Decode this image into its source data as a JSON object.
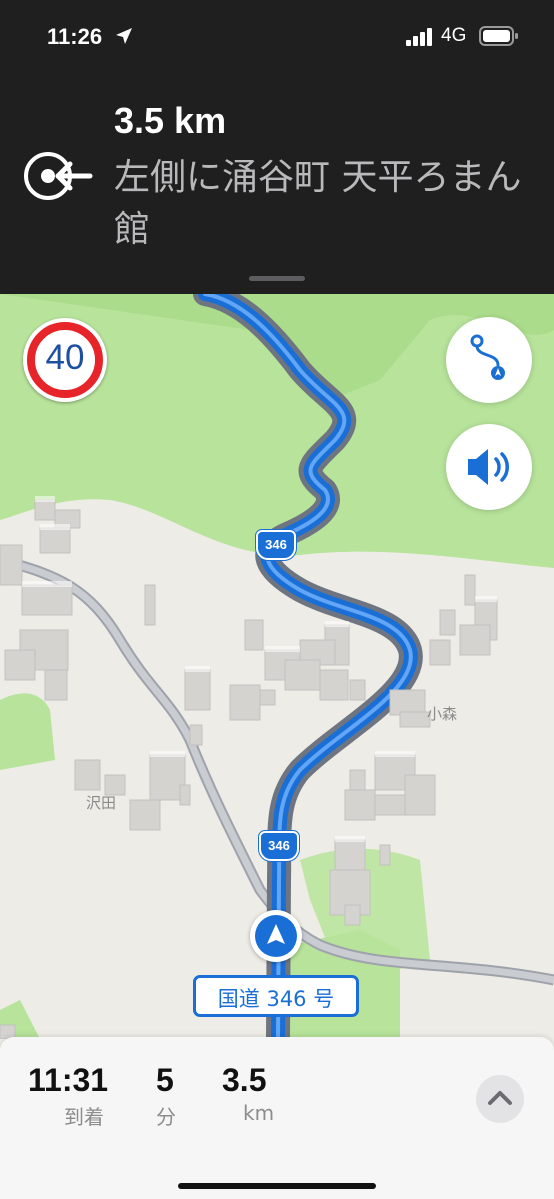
{
  "status_bar": {
    "time": "11:26",
    "network": "4G",
    "location_icon": "location-arrow-icon",
    "signal_icon": "cellular-signal-icon",
    "battery_icon": "battery-icon"
  },
  "guidance": {
    "distance": "3.5 km",
    "instruction": "左側に涌谷町 天平ろまん館",
    "maneuver_icon": "arrive-on-left-icon"
  },
  "map": {
    "speed_limit": "40",
    "route_shields": [
      "346",
      "346"
    ],
    "place_labels": [
      "小森",
      "沢田"
    ],
    "current_road": "国道 346 号",
    "buttons": {
      "route_overview_icon": "route-overview-icon",
      "audio_icon": "speaker-icon"
    },
    "colors": {
      "route": "#1a6fd6",
      "speed_ring": "#e8242b",
      "park": "#b7e39a"
    }
  },
  "trip": {
    "arrival_time": "11:31",
    "arrival_label": "到着",
    "minutes": "5",
    "minutes_label": "分",
    "distance": "3.5",
    "distance_label": "km",
    "expand_icon": "chevron-up-icon"
  }
}
